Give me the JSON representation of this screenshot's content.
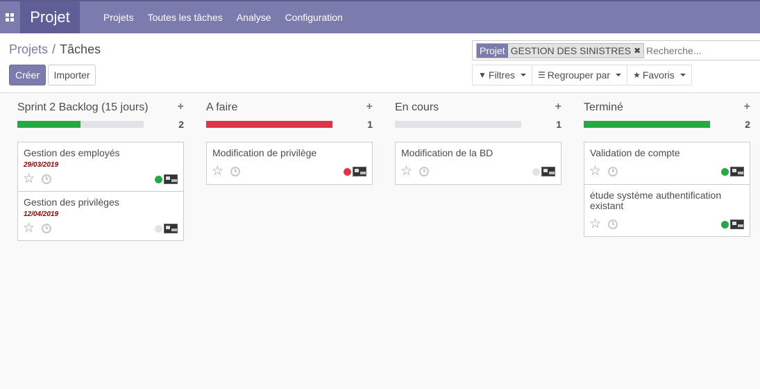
{
  "navbar": {
    "brand": "Projet",
    "menu": [
      "Projets",
      "Toutes les tâches",
      "Analyse",
      "Configuration"
    ]
  },
  "control": {
    "breadcrumb": {
      "parent": "Projets",
      "separator": "/",
      "current": "Tâches"
    },
    "create_label": "Créer",
    "import_label": "Importer",
    "search": {
      "facet_category": "Projet",
      "facet_value": "GESTION DES SINISTRES",
      "placeholder": "Recherche..."
    },
    "filters_label": "Filtres",
    "groupby_label": "Regrouper par",
    "favorites_label": "Favoris"
  },
  "colors": {
    "brand": "#7c7bad",
    "green": "#28a745",
    "red": "#dc3545",
    "grey_dot": "#e2e3e7",
    "date_red": "#8b0000"
  },
  "columns": [
    {
      "title": "Sprint 2 Backlog (15 jours)",
      "count": "2",
      "progress": [
        {
          "color": "#28a745",
          "fraction": 0.5
        }
      ],
      "cards": [
        {
          "title": "Gestion des employés",
          "date": "29/03/2019",
          "state": "#28a745"
        },
        {
          "title": "Gestion des privilèges",
          "date": "12/04/2019",
          "state": "#e2e3e7"
        }
      ]
    },
    {
      "title": "A faire",
      "count": "1",
      "progress": [
        {
          "color": "#dc3545",
          "fraction": 1.0
        }
      ],
      "cards": [
        {
          "title": "Modification de privilège",
          "date": "",
          "state": "#dc3545"
        }
      ]
    },
    {
      "title": "En cours",
      "count": "1",
      "progress": [],
      "cards": [
        {
          "title": "Modification de la BD",
          "date": "",
          "state": "#e2e3e7"
        }
      ]
    },
    {
      "title": "Terminé",
      "count": "2",
      "progress": [
        {
          "color": "#28a745",
          "fraction": 1.0
        }
      ],
      "cards": [
        {
          "title": "Validation de compte",
          "date": "",
          "state": "#28a745"
        },
        {
          "title": "étude système authentification existant",
          "date": "",
          "state": "#28a745"
        }
      ]
    }
  ]
}
